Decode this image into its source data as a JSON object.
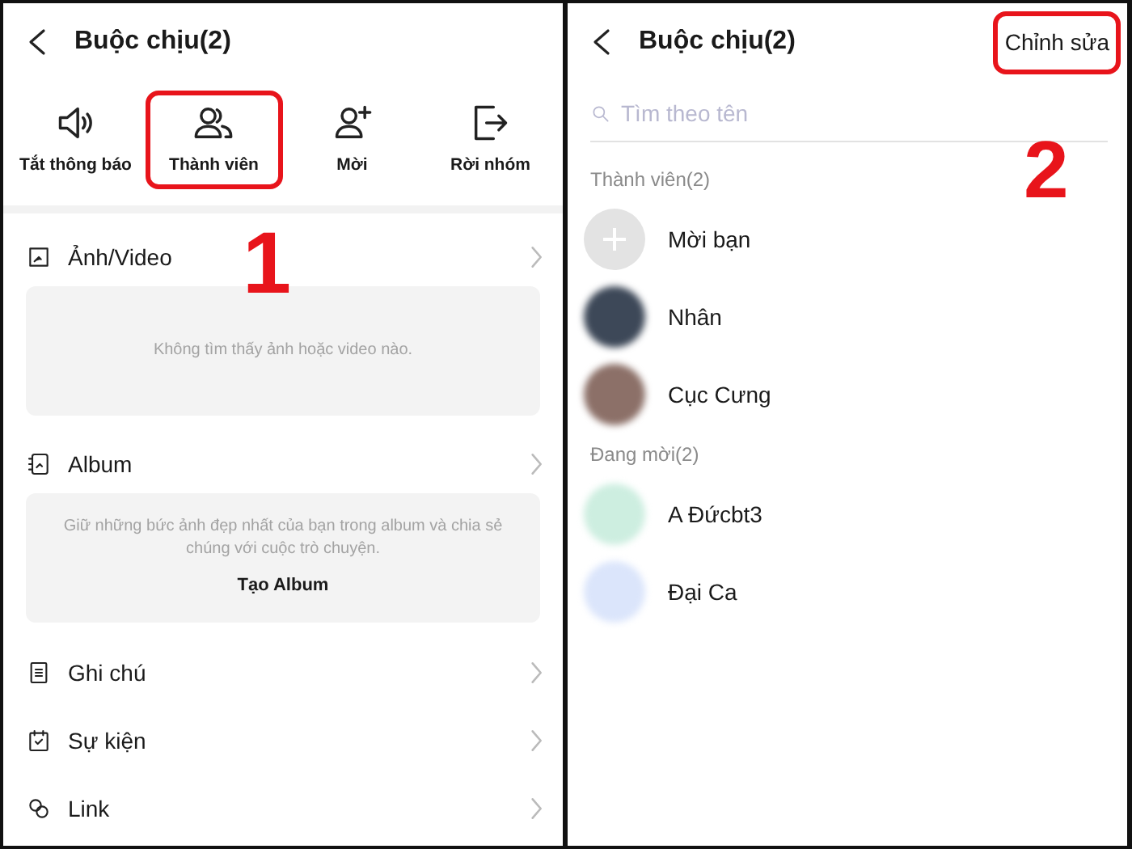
{
  "group_screen": {
    "title": "Buộc chịu(2)",
    "actions": [
      {
        "label": "Tắt thông báo",
        "highlighted": false
      },
      {
        "label": "Thành viên",
        "highlighted": true
      },
      {
        "label": "Mời",
        "highlighted": false
      },
      {
        "label": "Rời nhóm",
        "highlighted": false
      }
    ],
    "annotation": "1",
    "sections": [
      {
        "label": "Ảnh/Video",
        "note": "Không tìm thấy ảnh hoặc video nào."
      },
      {
        "label": "Album",
        "note": "Giữ những bức ảnh đẹp nhất của bạn trong album và chia sẻ chúng với cuộc trò chuyện.",
        "link": "Tạo Album"
      },
      {
        "label": "Ghi chú"
      },
      {
        "label": "Sự kiện"
      },
      {
        "label": "Link"
      }
    ]
  },
  "members_screen": {
    "title": "Buộc chịu(2)",
    "edit_button": {
      "label": "Chỉnh sửa",
      "highlighted": true
    },
    "search": {
      "placeholder": "Tìm theo tên"
    },
    "annotation": "2",
    "groups": [
      {
        "heading": "Thành viên(2)",
        "members": [
          {
            "kind": "invite",
            "name": "Mời bạn",
            "color": "#e3e3e3"
          },
          {
            "kind": "person",
            "name": "Nhân",
            "color": "#3d4858"
          },
          {
            "kind": "person",
            "name": "Cục Cưng",
            "color": "#8c7068"
          }
        ]
      },
      {
        "heading": "Đang mời(2)",
        "members": [
          {
            "kind": "person",
            "name": "A Đứcbt3",
            "color": "#cdeee0"
          },
          {
            "kind": "person",
            "name": "Đại Ca",
            "color": "#dbe5fb"
          }
        ]
      }
    ]
  }
}
